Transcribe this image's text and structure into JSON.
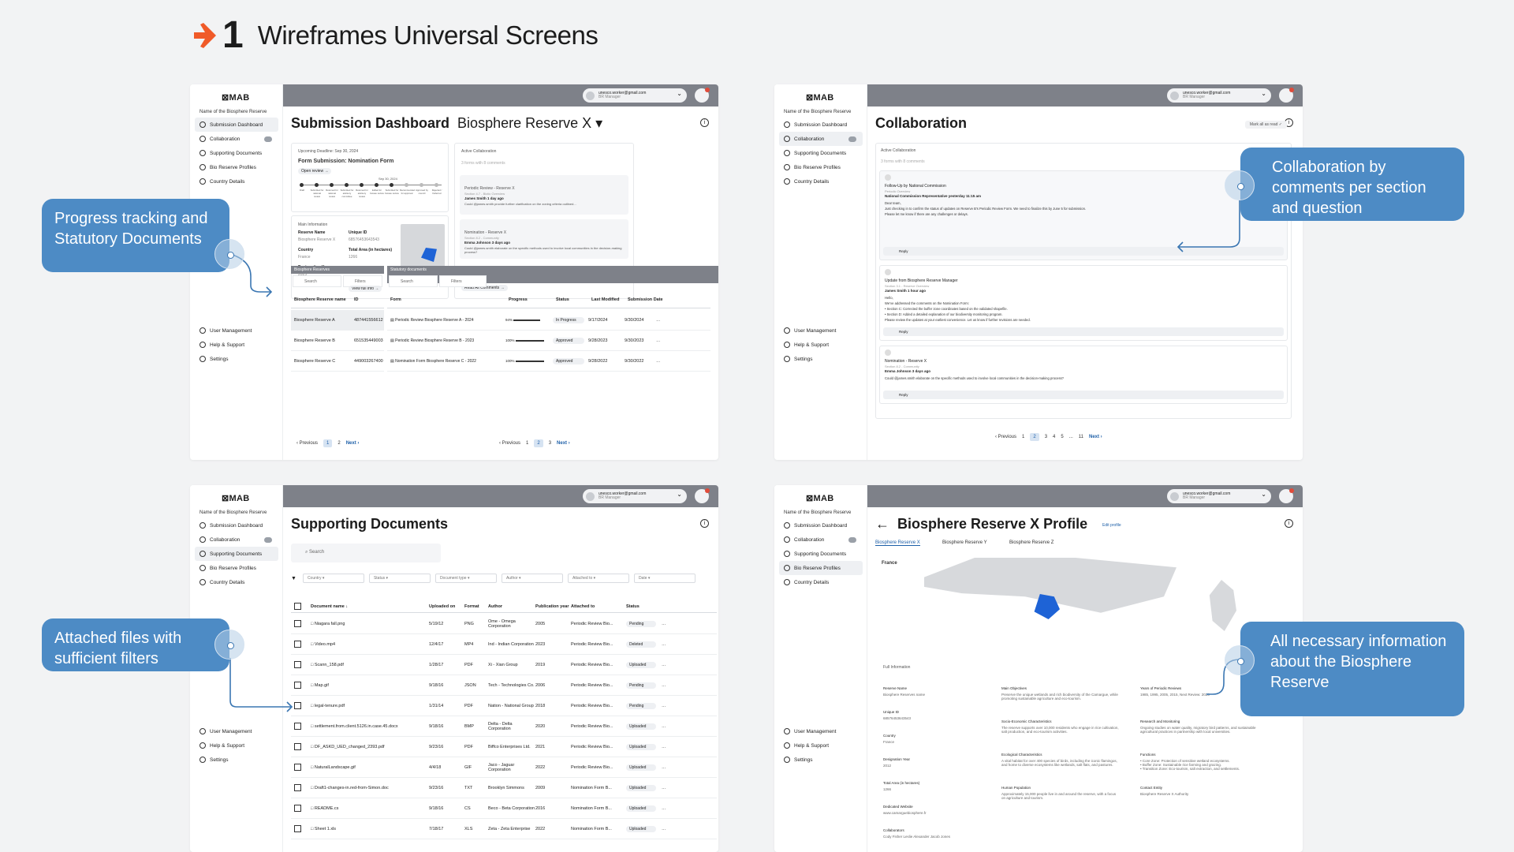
{
  "header": {
    "number": "1",
    "title": "Wireframes Universal Screens"
  },
  "common": {
    "logo": "⊠MAB",
    "br_name": "Name of the Biosphere Reserve",
    "user_email": "unesco.worker@gmail.com",
    "user_role": "BR Manager",
    "nav": [
      "Submission Dashboard",
      "Collaboration",
      "Supporting Documents",
      "Bio Reserve Profiles",
      "Country Details"
    ],
    "nav_bottom": [
      "User Management",
      "Help & Support",
      "Settings"
    ]
  },
  "dashboard": {
    "title": "Submission Dashboard",
    "reserve": "Biosphere Reserve X",
    "deadline_label": "Upcoming Deadline:",
    "deadline": "Sep 30, 2024",
    "form_title": "Form Submission: Nomination Form",
    "open_review": "Open review →",
    "timeline_date": "Sep 30, 2024",
    "steps": [
      "Draft",
      "Submitted for national review",
      "Returned for national review",
      "Submitted for advisory committee",
      "Returned for advisory review",
      "Edited for bureau review",
      "Submitted for bureau review",
      "Recommended for approval",
      "Approved by council",
      "Rejected / Deferred"
    ],
    "main_info": "Main Information",
    "fields": [
      [
        "Reserve Name",
        "Biosphere Reserve X"
      ],
      [
        "Unique ID",
        "68576453643543"
      ],
      [
        "Country",
        "France"
      ],
      [
        "Total Area (in hectares)",
        "1266"
      ],
      [
        "Designation Year",
        "2025"
      ]
    ],
    "view_full": "View full info →",
    "active_collab": "Active Collaboration",
    "collab_sub": "3 forms with 8 comments",
    "collab_items": [
      {
        "t": "Periodic Review - Reserve X",
        "s": "Section 4.7 - Biotic Overview",
        "a": "James Smith",
        "d": "1 day ago",
        "m": "Could @james.smith provide further clarification on the zoning criteria outlined..."
      },
      {
        "t": "Nomination - Reserve X",
        "s": "Section 8.2 - Community",
        "a": "Emma Johnson",
        "d": "3 days ago",
        "m": "Could @james.smith elaborate on the specific methods used to involve local communities in the decision-making process?"
      }
    ],
    "read_all": "Read All Comments →",
    "br_table": {
      "title": "Biosphere Reserves",
      "search": "Search",
      "filters": "Filters",
      "cols": [
        "Biosphere Reserve name",
        "ID"
      ],
      "rows": [
        [
          "Biosphere Reserve A",
          "487441556612"
        ],
        [
          "Biosphere Reserve B",
          "651535449003"
        ],
        [
          "Biosphere Reserve C",
          "449003267400"
        ]
      ]
    },
    "sd_table": {
      "title": "Statutory documents",
      "search": "Search",
      "filters": "Filters",
      "cols": [
        "Form",
        "Progress",
        "Status",
        "Last Modified",
        "Submission Date"
      ],
      "rows": [
        [
          "Periodic Review Biosphere Reserve A - 2024",
          "94%",
          "In Progress",
          "9/17/2024",
          "9/30/2024"
        ],
        [
          "Periodic Review Biosphere Reserve B - 2023",
          "100%",
          "Approved",
          "9/28/2023",
          "9/30/2023"
        ],
        [
          "Nomination Form Biosphere Reserve C - 2022",
          "100%",
          "Approved",
          "9/28/2022",
          "9/30/2022"
        ]
      ]
    },
    "pager1": [
      "Previous",
      "1",
      "2",
      "Next"
    ],
    "pager2": [
      "Previous",
      "1",
      "2",
      "3",
      "Next"
    ]
  },
  "collab": {
    "title": "Collaboration",
    "mark_all": "Mark all as read",
    "active": "Active Collaboration",
    "sub": "3 forms with 8 comments",
    "threads": [
      {
        "t": "Follow-Up by National Commission",
        "s": "Periodic Overview",
        "a": "National Commission Representative",
        "d": "yesterday 11:15 am",
        "body": [
          "Dear team,",
          "Just checking in to confirm the status of updates on Reserve B's Periodic Review Form. We need to finalize this by June 5 for submission.",
          "Please let me know if there are any challenges or delays."
        ]
      },
      {
        "t": "Update from Biosphere Reserve Manager",
        "s": "Section 3.1 - Reserve Overview",
        "a": "James Smith",
        "d": "1 hour ago",
        "body": [
          "Hello,",
          "We've addressed the comments on the Nomination Form:",
          "• Section C: Corrected the buffer zone coordinates based on the validated shapefile.",
          "• Section D: Added a detailed explanation of our biodiversity monitoring program.",
          "Please review the updates at your earliest convenience. Let us know if further revisions are needed."
        ]
      },
      {
        "t": "Nomination - Reserve X",
        "s": "Section 8.2 - Community",
        "a": "Emma Johnson",
        "d": "3 days ago",
        "body": [
          "Could @james.smith elaborate on the specific methods used to involve local communities in the decision-making process?"
        ]
      }
    ],
    "reply": "Reply",
    "pager": [
      "Previous",
      "1",
      "2",
      "3",
      "4",
      "5",
      "...",
      "11",
      "Next"
    ]
  },
  "docs": {
    "title": "Supporting Documents",
    "search": "Search",
    "filters": [
      "Country",
      "Status",
      "Document type",
      "Author",
      "Attached to",
      "Date"
    ],
    "cols": [
      "Document name",
      "Uploaded on",
      "Format",
      "Author",
      "Publication year",
      "Attached to",
      "Status"
    ],
    "rows": [
      [
        "Niagara fall.png",
        "5/19/12",
        "PNG",
        "Ome - Omega Corporation",
        "2005",
        "Periodic Review Bio...",
        "Pending"
      ],
      [
        "Video.mp4",
        "12/4/17",
        "MP4",
        "Ind - Indian Corporation",
        "2023",
        "Periodic Review Bio...",
        "Deleted"
      ],
      [
        "Scann_158.pdf",
        "1/28/17",
        "PDF",
        "Xi - Xian Group",
        "2019",
        "Periodic Review Bio...",
        "Uploaded"
      ],
      [
        "Map.gif",
        "9/18/16",
        "JSON",
        "Tech - Technologies Co.",
        "2006",
        "Periodic Review Bio...",
        "Pending"
      ],
      [
        "legal-tenure.pdf",
        "1/31/14",
        "PDF",
        "Nation - National Group",
        "2018",
        "Periodic Review Bio...",
        "Pending"
      ],
      [
        "settlement.from.client.5126.in.case.45.docx",
        "9/18/16",
        "BMP",
        "Delta - Delta Corporation",
        "2020",
        "Periodic Review Bio...",
        "Uploaded"
      ],
      [
        "DF_ASKD_UED_changed_2393.pdf",
        "9/23/16",
        "PDF",
        "Biffco Enterprises Ltd.",
        "2021",
        "Periodic Review Bio...",
        "Uploaded"
      ],
      [
        "NaturalLandscape.gif",
        "4/4/18",
        "GIF",
        "Jaco - Jaguar Corporation",
        "2022",
        "Periodic Review Bio...",
        "Uploaded"
      ],
      [
        "Draft1-changes-in.red-from-Simon.doc",
        "9/23/16",
        "TXT",
        "Brooklyn Simmons",
        "2009",
        "Nomination Form B...",
        "Uploaded"
      ],
      [
        "README.cs",
        "9/18/16",
        "CS",
        "Beco - Beta Corporation",
        "2016",
        "Nomination Form B...",
        "Uploaded"
      ],
      [
        "Sheet 1.xls",
        "7/18/17",
        "XLS",
        "Zeta - Zeta Enterprise",
        "2022",
        "Nomination Form B...",
        "Uploaded"
      ]
    ]
  },
  "profile": {
    "title": "Biosphere Reserve X Profile",
    "edit": "Edit profile",
    "tabs": [
      "Biosphere Reserve X",
      "Biosphere Reserve Y",
      "Biosphere Reserve Z"
    ],
    "country": "France",
    "full_info": "Full Information",
    "col1": [
      [
        "Reserve Name",
        "Biosphere Reserves name"
      ],
      [
        "Unique ID",
        "68576453643543"
      ],
      [
        "Country",
        "France"
      ],
      [
        "Designation Year",
        "2012"
      ],
      [
        "Total Area (in hectares)",
        "1266"
      ],
      [
        "Dedicated Website",
        "www.camarguebiosphere.fr"
      ],
      [
        "Collaborators",
        "Cody Fisher  Leslie Alexander  Jacob Jones"
      ]
    ],
    "col2": [
      [
        "Main Objectives",
        "Preserve the unique wetlands and rich biodiversity of the Camargue, while promoting sustainable agriculture and eco-tourism."
      ],
      [
        "Socio-Economic Characteristics",
        "The reserve supports over 10,000 residents who engage in rice cultivation, salt production, and eco-tourism activities."
      ],
      [
        "Ecological Characteristics",
        "A vital habitat for over 400 species of birds, including the iconic flamingos, and home to diverse ecosystems like wetlands, salt flats, and pastures."
      ],
      [
        "Human Population",
        "Approximately 15,000 people live in and around the reserve, with a focus on agriculture and tourism."
      ]
    ],
    "col3": [
      [
        "Years of Periodic Reviews",
        "1985, 1995, 2005, 2015, Next Review: 2025"
      ],
      [
        "Research and Monitoring",
        "Ongoing studies on water quality, migratory bird patterns, and sustainable agricultural practices in partnership with local universities."
      ],
      [
        "Functions",
        "• Core Zone: Protection of sensitive wetland ecosystems.\n• Buffer Zone: Sustainable rice farming and grazing.\n• Transition Zone: Eco-tourism, salt extraction, and settlements."
      ],
      [
        "Contact Entity",
        "Biosphere Reserve X Authority"
      ]
    ]
  },
  "callouts": {
    "progress": "Progress tracking and Statutory Documents",
    "collab": "Collaboration by comments per section and question",
    "files": "Attached files with sufficient filters",
    "info": "All necessary information about the Biosphere Reserve"
  },
  "colors": {
    "accent": "#4d8bc5",
    "topbar": "#7e8189",
    "brand_orange": "#f05a28",
    "map_highlight": "#1e63d6"
  }
}
